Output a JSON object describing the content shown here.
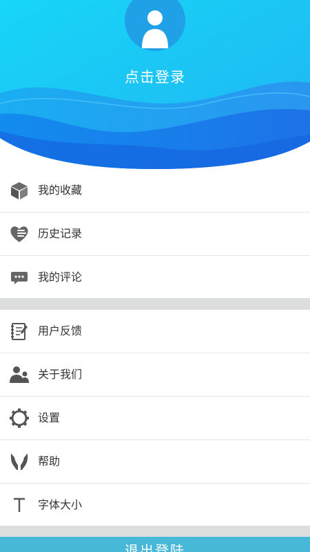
{
  "header": {
    "login_label": "点击登录"
  },
  "menu": {
    "group1": [
      {
        "label": "我的收藏",
        "icon": "box-icon"
      },
      {
        "label": "历史记录",
        "icon": "heart-chat-icon"
      },
      {
        "label": "我的评论",
        "icon": "comment-icon"
      }
    ],
    "group2": [
      {
        "label": "用户反馈",
        "icon": "notebook-icon"
      },
      {
        "label": "关于我们",
        "icon": "people-icon"
      },
      {
        "label": "设置",
        "icon": "gear-icon"
      },
      {
        "label": "帮助",
        "icon": "hands-icon"
      },
      {
        "label": "字体大小",
        "icon": "text-size-icon"
      }
    ]
  },
  "logout_label": "退出登陆",
  "colors": {
    "header_top": "#1fd0f5",
    "header_bottom": "#1a6ee6",
    "icon_gray": "#666666",
    "separator": "#dcdddd",
    "logout_bg": "#48b8d8"
  }
}
